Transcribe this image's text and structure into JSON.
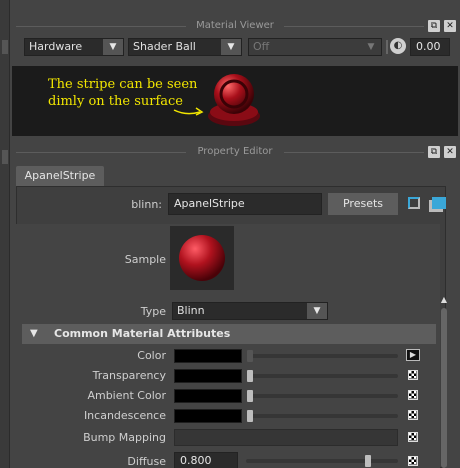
{
  "material_viewer": {
    "title": "Material Viewer",
    "renderer": "Hardware",
    "geometry": "Shader Ball",
    "environment": "Off",
    "exposure": "0.00",
    "annotation_line1": "The stripe can be seen",
    "annotation_line2": "dimly on the surface"
  },
  "property_editor": {
    "title": "Property Editor",
    "tab": "ApanelStripe",
    "node_type_label": "blinn:",
    "node_name": "ApanelStripe",
    "presets_label": "Presets",
    "sample_label": "Sample",
    "type_label": "Type",
    "type_value": "Blinn",
    "section_title": "Common Material Attributes",
    "attributes": [
      {
        "label": "Color"
      },
      {
        "label": "Transparency"
      },
      {
        "label": "Ambient Color"
      },
      {
        "label": "Incandescence"
      },
      {
        "label": "Bump Mapping"
      },
      {
        "label": "Diffuse",
        "value": "0.800",
        "level": 0.8
      }
    ]
  },
  "colors": {
    "annotation": "#f2e600",
    "accent_icon": "#3aa7d8",
    "sample_ball": "#b0121e"
  }
}
